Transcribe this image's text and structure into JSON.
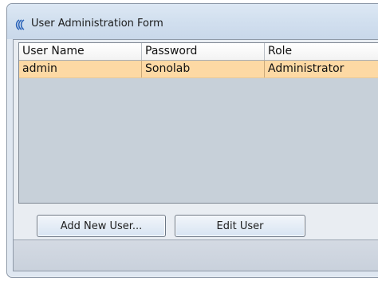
{
  "window": {
    "title": "User Administration Form",
    "icon": "app-logo-icon"
  },
  "grid": {
    "columns": [
      "User Name",
      "Password",
      "Role"
    ],
    "rows": [
      [
        "admin",
        "Sonolab",
        "Administrator"
      ]
    ],
    "selected_row_color": "#fdd9a4"
  },
  "buttons": {
    "add_user": "Add New User...",
    "edit_user": "Edit User"
  }
}
